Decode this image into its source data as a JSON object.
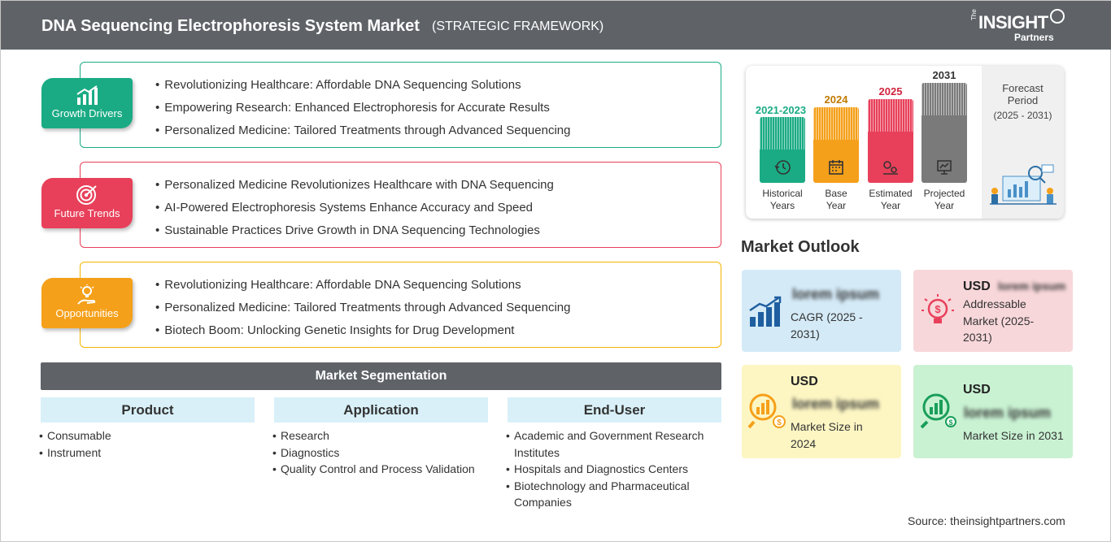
{
  "header": {
    "title": "DNA Sequencing Electrophoresis System Market",
    "subtitle": "(STRATEGIC FRAMEWORK)",
    "logo": {
      "the": "The",
      "insight": "INSIGHT",
      "partners": "Partners"
    }
  },
  "framework": {
    "growth_drivers": {
      "label": "Growth Drivers",
      "color": "#1aab84",
      "icon": "bar-chart-growth-icon",
      "items": [
        "Revolutionizing Healthcare: Affordable DNA Sequencing Solutions",
        "Empowering Research: Enhanced Electrophoresis for Accurate Results",
        "Personalized Medicine: Tailored Treatments through Advanced Sequencing"
      ]
    },
    "future_trends": {
      "label": "Future Trends",
      "color": "#e8405a",
      "icon": "target-icon",
      "items": [
        "Personalized Medicine Revolutionizes Healthcare with DNA Sequencing",
        "AI-Powered Electrophoresis Systems Enhance Accuracy and Speed",
        "Sustainable Practices Drive Growth in DNA Sequencing Technologies"
      ]
    },
    "opportunities": {
      "label": "Opportunities",
      "color": "#f5a01a",
      "icon": "lightbulb-hand-icon",
      "items": [
        "Revolutionizing Healthcare: Affordable DNA Sequencing Solutions",
        "Personalized Medicine: Tailored Treatments through Advanced Sequencing",
        "Biotech Boom: Unlocking Genetic Insights for Drug Development"
      ]
    }
  },
  "segmentation": {
    "title": "Market Segmentation",
    "product": {
      "heading": "Product",
      "items": [
        "Consumable",
        "Instrument"
      ]
    },
    "application": {
      "heading": "Application",
      "items": [
        "Research",
        "Diagnostics",
        "Quality Control and Process Validation"
      ]
    },
    "end_user": {
      "heading": "End-User",
      "lines": [
        "Academic and Government Research",
        "Institutes",
        "Hospitals and Diagnostics Centers",
        "Biotechnology and Pharmaceutical",
        "Companies"
      ]
    }
  },
  "timeline": {
    "historical": {
      "year": "2021-2023",
      "label1": "Historical",
      "label2": "Years",
      "color": "#1aab84"
    },
    "base": {
      "year": "2024",
      "label1": "Base",
      "label2": "Year",
      "color": "#f5a01a"
    },
    "estimated": {
      "year": "2025",
      "label1": "Estimated",
      "label2": "Year",
      "color": "#e8405a"
    },
    "projected": {
      "year": "2031",
      "label1": "Projected",
      "label2": "Year",
      "color": "#7a7a7a"
    },
    "forecast": {
      "title1": "Forecast",
      "title2": "Period",
      "range": "(2025 - 2031)"
    }
  },
  "market_outlook": {
    "title": "Market Outlook",
    "cagr": {
      "value": "lorem ipsum",
      "label1": "CAGR (2025 -",
      "label2": "2031)",
      "bg": "#d4eaf7"
    },
    "addressable": {
      "usd": "USD",
      "value": "lorem ipsum",
      "label1": "Addressable",
      "label2": "Market (2025-",
      "label3": "2031)",
      "bg": "#f8d7da"
    },
    "size_2024": {
      "usd": "USD",
      "value": "lorem ipsum",
      "label1": "Market Size in",
      "label2": "2024",
      "bg": "#fdf6c3"
    },
    "size_2031": {
      "usd": "USD",
      "value": "lorem ipsum",
      "label": "Market Size in 2031",
      "bg": "#c9f2d3"
    }
  },
  "source": "Source: theinsightpartners.com"
}
